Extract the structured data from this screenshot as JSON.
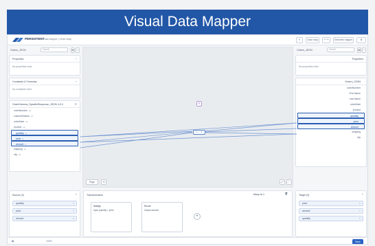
{
  "banner": {
    "title": "Visual Data Mapper"
  },
  "topbar": {
    "logo_text": "PERSISTENT",
    "crumbs": "Data Mapper   |   Order Map",
    "btn_1": "≡",
    "btn_2": "Save map",
    "btn_3": "↶  ↷",
    "btn_4": "Overview mapper",
    "btn_5": "⚙"
  },
  "left": {
    "toolbar_label": "Orders_JSON",
    "search_placeholder": "Search",
    "properties_title": "Properties",
    "properties_empty": "No properties exist",
    "constants_title": "Constants & Formulas",
    "constants_empty": "No constants exist",
    "schema_title": "OrderSchema_SpecificResponse_JSON 4.0.0",
    "fields": [
      {
        "label": "orderNumber",
        "sub": "str",
        "selected": false
      },
      {
        "label": "customerName",
        "sub": "str",
        "selected": false
      },
      {
        "label": "orderDate",
        "sub": "str",
        "selected": false
      },
      {
        "label": "product",
        "sub": "str",
        "selected": false
      },
      {
        "label": "quantity",
        "sub": "#",
        "selected": true
      },
      {
        "label": "price",
        "sub": "#",
        "selected": true
      },
      {
        "label": "amount",
        "sub": "#",
        "selected": true
      },
      {
        "label": "shipping",
        "sub": "str",
        "selected": false
      },
      {
        "label": "city",
        "sub": "str",
        "selected": false
      }
    ]
  },
  "right": {
    "toolbar_label": "Orders_JSON",
    "search_placeholder": "Search",
    "properties_title": "Properties",
    "properties_empty": "No properties exist",
    "schema_title": "Orders_JSON",
    "fields": [
      {
        "label": "orderNumber",
        "selected": false
      },
      {
        "label": "First Name",
        "selected": false
      },
      {
        "label": "Last Name",
        "selected": false
      },
      {
        "label": "orderDate",
        "selected": false
      },
      {
        "label": "product",
        "selected": false
      },
      {
        "label": "quantity",
        "selected": true
      },
      {
        "label": "price",
        "selected": true
      },
      {
        "label": "amount",
        "selected": true
      },
      {
        "label": "shipping",
        "selected": false
      },
      {
        "label": "city",
        "selected": false
      }
    ]
  },
  "canvas": {
    "center_node": "1 → 3",
    "badge": "<",
    "zoom_label": "Page",
    "zoom_btn": "⟲"
  },
  "bottom": {
    "source_title": "Source (3)",
    "source_items": [
      "quantity",
      "price",
      "amount"
    ],
    "transform_title": "Transformation",
    "transform_mode": "Many-to-1",
    "card1_title": "Multiply",
    "card1_body": "Input  quantity  ×  price",
    "card2_title": "Round",
    "card2_body": "Output  amount",
    "target_title": "Target (3)",
    "target_items": [
      "price",
      "amount",
      "quantity"
    ]
  },
  "footer": {
    "zoom_text": "100%",
    "save_label": "Save"
  }
}
